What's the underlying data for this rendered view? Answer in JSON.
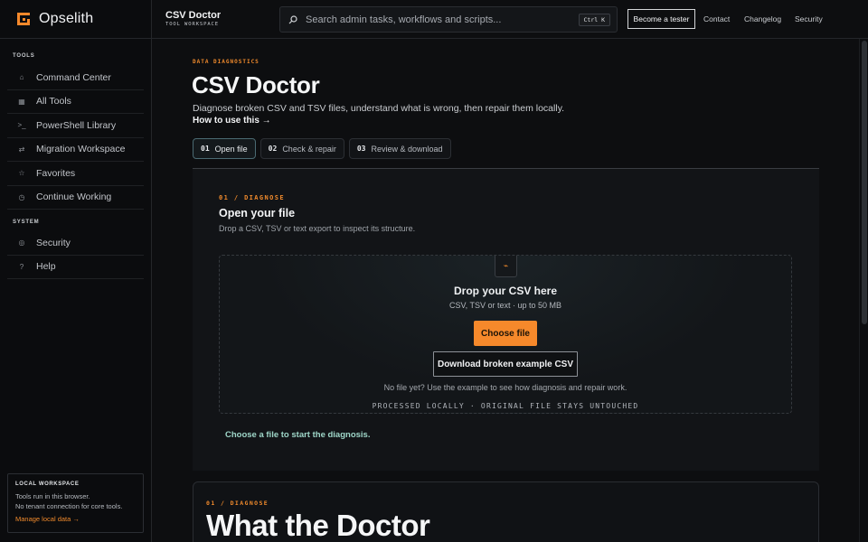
{
  "brand": {
    "name": "Opselith"
  },
  "sidebar": {
    "tools_heading": "TOOLS",
    "tools": [
      {
        "icon": "home-icon",
        "glyph": "⌂",
        "label": "Command Center"
      },
      {
        "icon": "grid-icon",
        "glyph": "▦",
        "label": "All Tools"
      },
      {
        "icon": "terminal-icon",
        "glyph": ">_",
        "label": "PowerShell Library"
      },
      {
        "icon": "swap-icon",
        "glyph": "⇄",
        "label": "Migration Workspace"
      },
      {
        "icon": "star-icon",
        "glyph": "☆",
        "label": "Favorites"
      },
      {
        "icon": "clock-icon",
        "glyph": "◷",
        "label": "Continue Working"
      }
    ],
    "system_heading": "SYSTEM",
    "system": [
      {
        "icon": "shield-icon",
        "glyph": "◎",
        "label": "Security"
      },
      {
        "icon": "help-icon",
        "glyph": "?",
        "label": "Help"
      }
    ],
    "workspace": {
      "title": "LOCAL WORKSPACE",
      "line1": "Tools run in this browser.",
      "line2": "No tenant connection for core tools.",
      "link": "Manage local data →"
    }
  },
  "topbar": {
    "title": "CSV Doctor",
    "subtitle": "TOOL WORKSPACE",
    "search_placeholder": "Search admin tasks, workflows and scripts...",
    "shortcut": "Ctrl K",
    "tester_label": "Become a tester",
    "links": [
      "Contact",
      "Changelog",
      "Security"
    ]
  },
  "main": {
    "eyebrow": "DATA DIAGNOSTICS",
    "title": "CSV Doctor",
    "description": "Diagnose broken CSV and TSV files, understand what is wrong, then repair them locally.",
    "howto": "How to use this →",
    "steps": [
      {
        "num": "01",
        "label": "Open file",
        "active": true
      },
      {
        "num": "02",
        "label": "Check & repair",
        "active": false
      },
      {
        "num": "03",
        "label": "Review & download",
        "active": false
      }
    ],
    "panel": {
      "eyebrow": "01 / DIAGNOSE",
      "title": "Open your file",
      "subtitle": "Drop a CSV, TSV or text export to inspect its structure.",
      "drop_icon": "⌁",
      "drop_title": "Drop your CSV here",
      "drop_subtitle": "CSV, TSV or text · up to 50 MB",
      "choose_label": "Choose file",
      "example_label": "Download broken example CSV",
      "note": "No file yet? Use the example to see how diagnosis and repair work.",
      "footer": "PROCESSED LOCALLY · ORIGINAL FILE STAYS UNTOUCHED",
      "status": "Choose a file to start the diagnosis."
    },
    "panel2": {
      "eyebrow": "01 / DIAGNOSE",
      "title": "What the Doctor"
    }
  },
  "colors": {
    "accent": "#f6892b",
    "background": "#0d0e10",
    "status": "#9fd7c9"
  }
}
